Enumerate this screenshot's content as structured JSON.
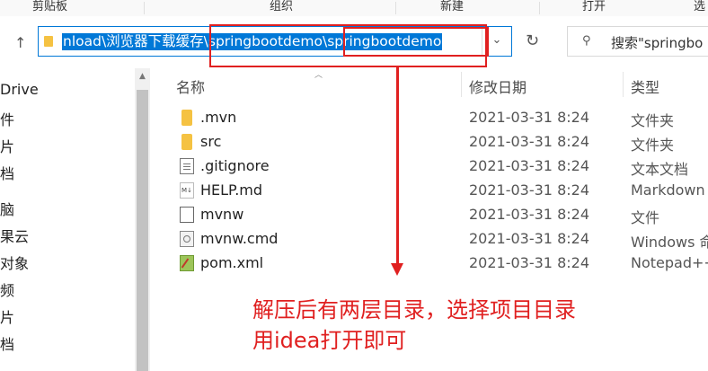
{
  "ribbon": {
    "groups": [
      "剪贴板",
      "组织",
      "新建",
      "打开",
      "选"
    ]
  },
  "address": {
    "path": "nload\\浏览器下载缓存\\springbootdemo\\springbootdemo",
    "dropdown_icon": "chevron-down",
    "refresh_icon": "refresh"
  },
  "search": {
    "text": "搜索\"springbo"
  },
  "nav": {
    "items": [
      "Drive",
      "件",
      "片",
      "档",
      "脑",
      "果云",
      "对象",
      "频",
      "片",
      "档"
    ]
  },
  "columns": {
    "name": "名称",
    "date": "修改日期",
    "type": "类型"
  },
  "files": [
    {
      "name": ".mvn",
      "date": "2021-03-31 8:24",
      "type": "文件夹",
      "icon": "folder"
    },
    {
      "name": "src",
      "date": "2021-03-31 8:24",
      "type": "文件夹",
      "icon": "folder"
    },
    {
      "name": ".gitignore",
      "date": "2021-03-31 8:24",
      "type": "文本文档",
      "icon": "text-file"
    },
    {
      "name": "HELP.md",
      "date": "2021-03-31 8:24",
      "type": "Markdown",
      "icon": "markdown-file"
    },
    {
      "name": "mvnw",
      "date": "2021-03-31 8:24",
      "type": "文件",
      "icon": "blank-file"
    },
    {
      "name": "mvnw.cmd",
      "date": "2021-03-31 8:24",
      "type": "Windows 命",
      "icon": "cmd-file"
    },
    {
      "name": "pom.xml",
      "date": "2021-03-31 8:24",
      "type": "Notepad++",
      "icon": "xml-file"
    }
  ],
  "annotation": {
    "line1": "解压后有两层目录，选择项目目录",
    "line2": "用idea打开即可"
  },
  "colors": {
    "accent": "#0078d7",
    "annotation_red": "#e02020",
    "folder": "#f5c242"
  }
}
